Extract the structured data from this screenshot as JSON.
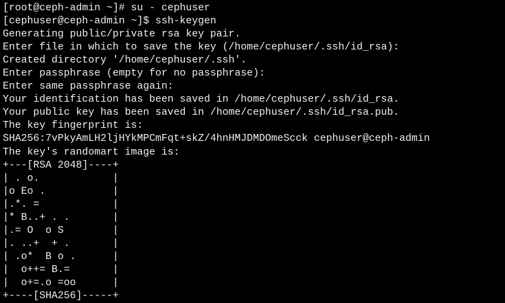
{
  "terminal": {
    "lines": [
      "[root@ceph-admin ~]# su - cephuser",
      "[cephuser@ceph-admin ~]$ ssh-keygen",
      "Generating public/private rsa key pair.",
      "Enter file in which to save the key (/home/cephuser/.ssh/id_rsa):",
      "Created directory '/home/cephuser/.ssh'.",
      "Enter passphrase (empty for no passphrase):",
      "Enter same passphrase again:",
      "Your identification has been saved in /home/cephuser/.ssh/id_rsa.",
      "Your public key has been saved in /home/cephuser/.ssh/id_rsa.pub.",
      "The key fingerprint is:",
      "SHA256:7vPkyAmLH2ljHYkMPCmFqt+skZ/4hnHMJDMDOmeScck cephuser@ceph-admin",
      "The key's randomart image is:",
      "+---[RSA 2048]----+",
      "| . o.            |",
      "|o Eo .           |",
      "|.*. =            |",
      "|* B..+ . .       |",
      "|.= O  o S        |",
      "|. ..+  + .       |",
      "| .o*  B o .      |",
      "|  o++= B.=       |",
      "|  o+=.o =oo      |",
      "+----[SHA256]-----+"
    ]
  }
}
